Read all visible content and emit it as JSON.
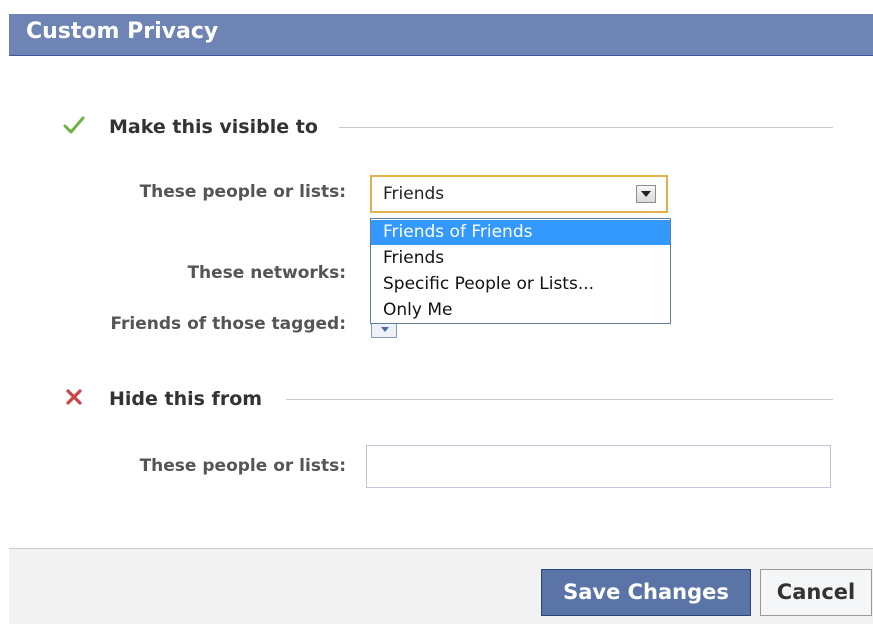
{
  "dialog": {
    "title": "Custom Privacy"
  },
  "visible_section": {
    "icon": "checkmark-icon",
    "icon_color": "#6db33f",
    "heading": "Make this visible to",
    "people_label": "These people or lists:",
    "people_selected": "Friends",
    "people_options": [
      "Friends of Friends",
      "Friends",
      "Specific People or Lists...",
      "Only Me"
    ],
    "highlighted_option": "Friends of Friends",
    "networks_label": "These networks:",
    "tagged_label": "Friends of those tagged:"
  },
  "hide_section": {
    "icon": "x-icon",
    "icon_color": "#cc4444",
    "heading": "Hide this from",
    "people_label": "These people or lists:",
    "people_value": ""
  },
  "footer": {
    "save_label": "Save Changes",
    "cancel_label": "Cancel"
  },
  "colors": {
    "title_bar": "#6d84b4",
    "primary_button": "#5b74a8",
    "highlight": "#3399ff",
    "select_focus_border": "#e3b04b"
  }
}
